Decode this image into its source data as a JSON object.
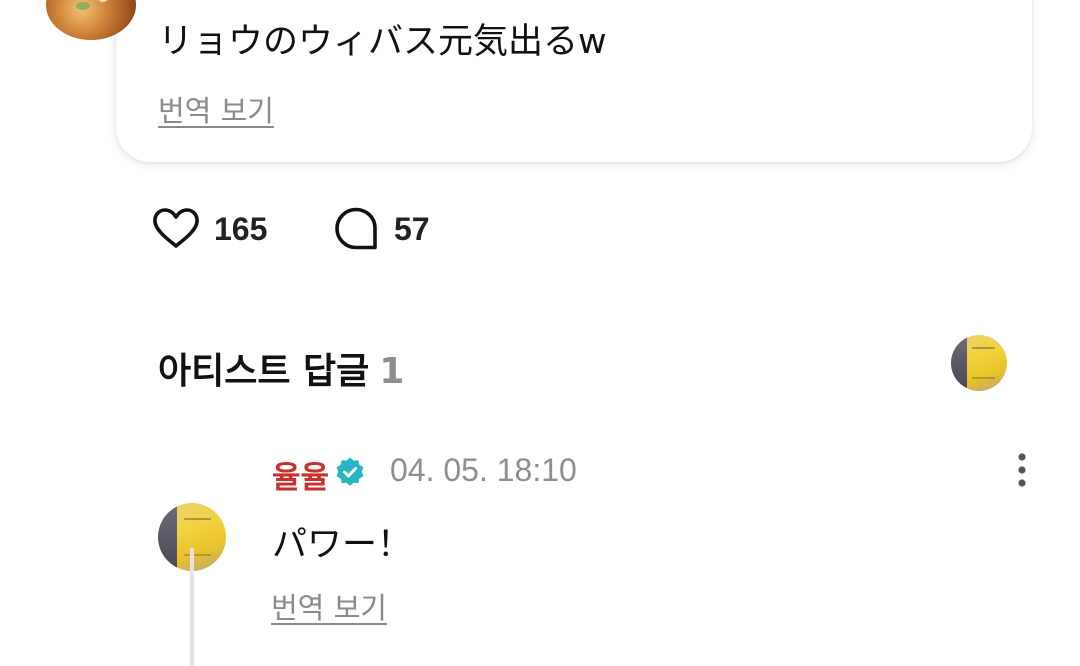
{
  "post": {
    "text": "リョウのウィバス元気出るw",
    "translate_label": "번역 보기"
  },
  "stats": {
    "likes": "165",
    "comments": "57"
  },
  "artist_replies": {
    "title": "아티스트 답글",
    "count": "1"
  },
  "reply": {
    "author": "율율",
    "timestamp": "04. 05. 18:10",
    "text": "パワー！",
    "translate_label": "번역 보기"
  },
  "colors": {
    "author_name": "#c8322c",
    "verified_badge": "#26b5c2",
    "muted_text": "#8e8e8e"
  },
  "icons": {
    "like": "heart-icon",
    "comment": "comment-bubble-icon",
    "verified": "verified-badge-icon",
    "more": "more-vertical-icon"
  }
}
